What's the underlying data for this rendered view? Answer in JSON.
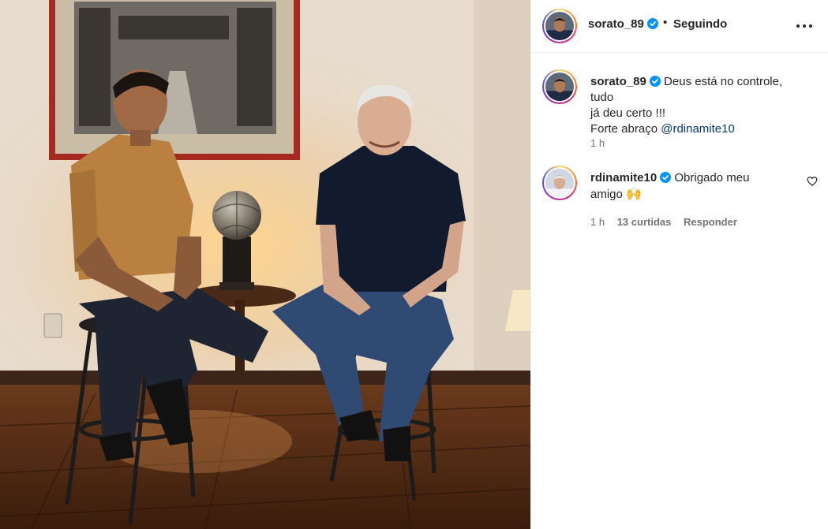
{
  "post": {
    "username": "sorato_89",
    "follow_separator": "•",
    "follow_status": "Seguindo",
    "more_icon": "more-options-icon"
  },
  "comments": [
    {
      "username": "sorato_89",
      "text_line1": "Deus está no controle, tudo",
      "text_line2": "já deu certo !!!",
      "text_line3_prefix": "Forte abraço ",
      "mention": "@rdinamite10",
      "time": "1 h"
    },
    {
      "username": "rdinamite10",
      "text_line1": "Obrigado meu",
      "text_line2": "amigo",
      "emoji": "🙌",
      "time": "1 h",
      "likes": "13 curtidas",
      "reply": "Responder"
    }
  ],
  "colors": {
    "text": "#262626",
    "secondary": "#737373",
    "link": "#00376b",
    "verified": "#0095f6",
    "border": "#efefef"
  }
}
